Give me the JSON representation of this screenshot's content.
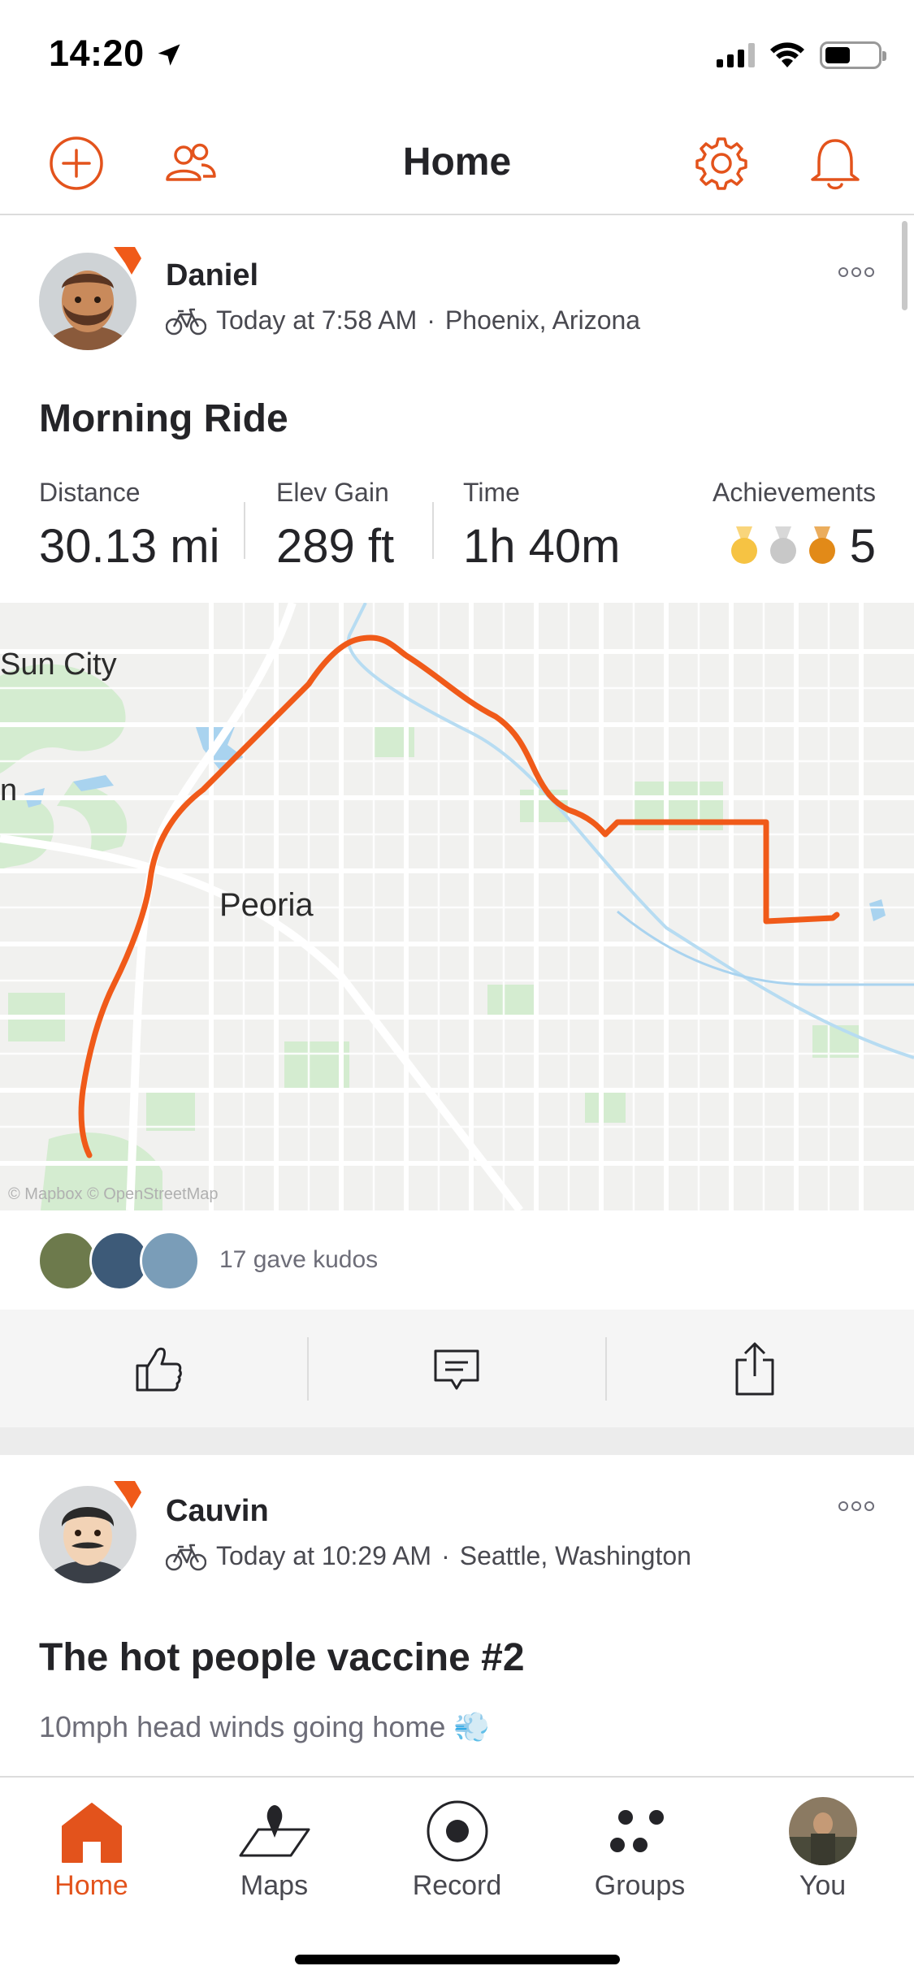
{
  "status_bar": {
    "time": "14:20"
  },
  "header": {
    "title": "Home"
  },
  "feed": [
    {
      "athlete_name": "Daniel",
      "timestamp": "Today at 7:58 AM",
      "separator": "·",
      "location": "Phoenix, Arizona",
      "title": "Morning Ride",
      "stats": {
        "distance_label": "Distance",
        "distance_value": "30.13 mi",
        "elev_label": "Elev Gain",
        "elev_value": "289 ft",
        "time_label": "Time",
        "time_value": "1h 40m",
        "achievements_label": "Achievements",
        "achievements_count": "5"
      },
      "map": {
        "labels": [
          "Sun City",
          "Peoria",
          "n"
        ],
        "attribution": "© Mapbox © OpenStreetMap"
      },
      "kudos_text": "17 gave kudos"
    },
    {
      "athlete_name": "Cauvin",
      "timestamp": "Today at 10:29 AM",
      "separator": "·",
      "location": "Seattle, Washington",
      "title": "The hot people vaccine #2",
      "description": "10mph head winds going home 💨"
    }
  ],
  "tabs": [
    {
      "label": "Home",
      "icon": "home-icon",
      "active": true
    },
    {
      "label": "Maps",
      "icon": "maps-icon",
      "active": false
    },
    {
      "label": "Record",
      "icon": "record-icon",
      "active": false
    },
    {
      "label": "Groups",
      "icon": "groups-icon",
      "active": false
    },
    {
      "label": "You",
      "icon": "profile-avatar",
      "active": false
    }
  ],
  "colors": {
    "accent": "#e3531c",
    "route": "#f05a19",
    "text": "#242428",
    "muted": "#494950",
    "medal_gold": "#f6c343",
    "medal_silver": "#c8c8c8",
    "medal_bronze": "#e28a18"
  }
}
